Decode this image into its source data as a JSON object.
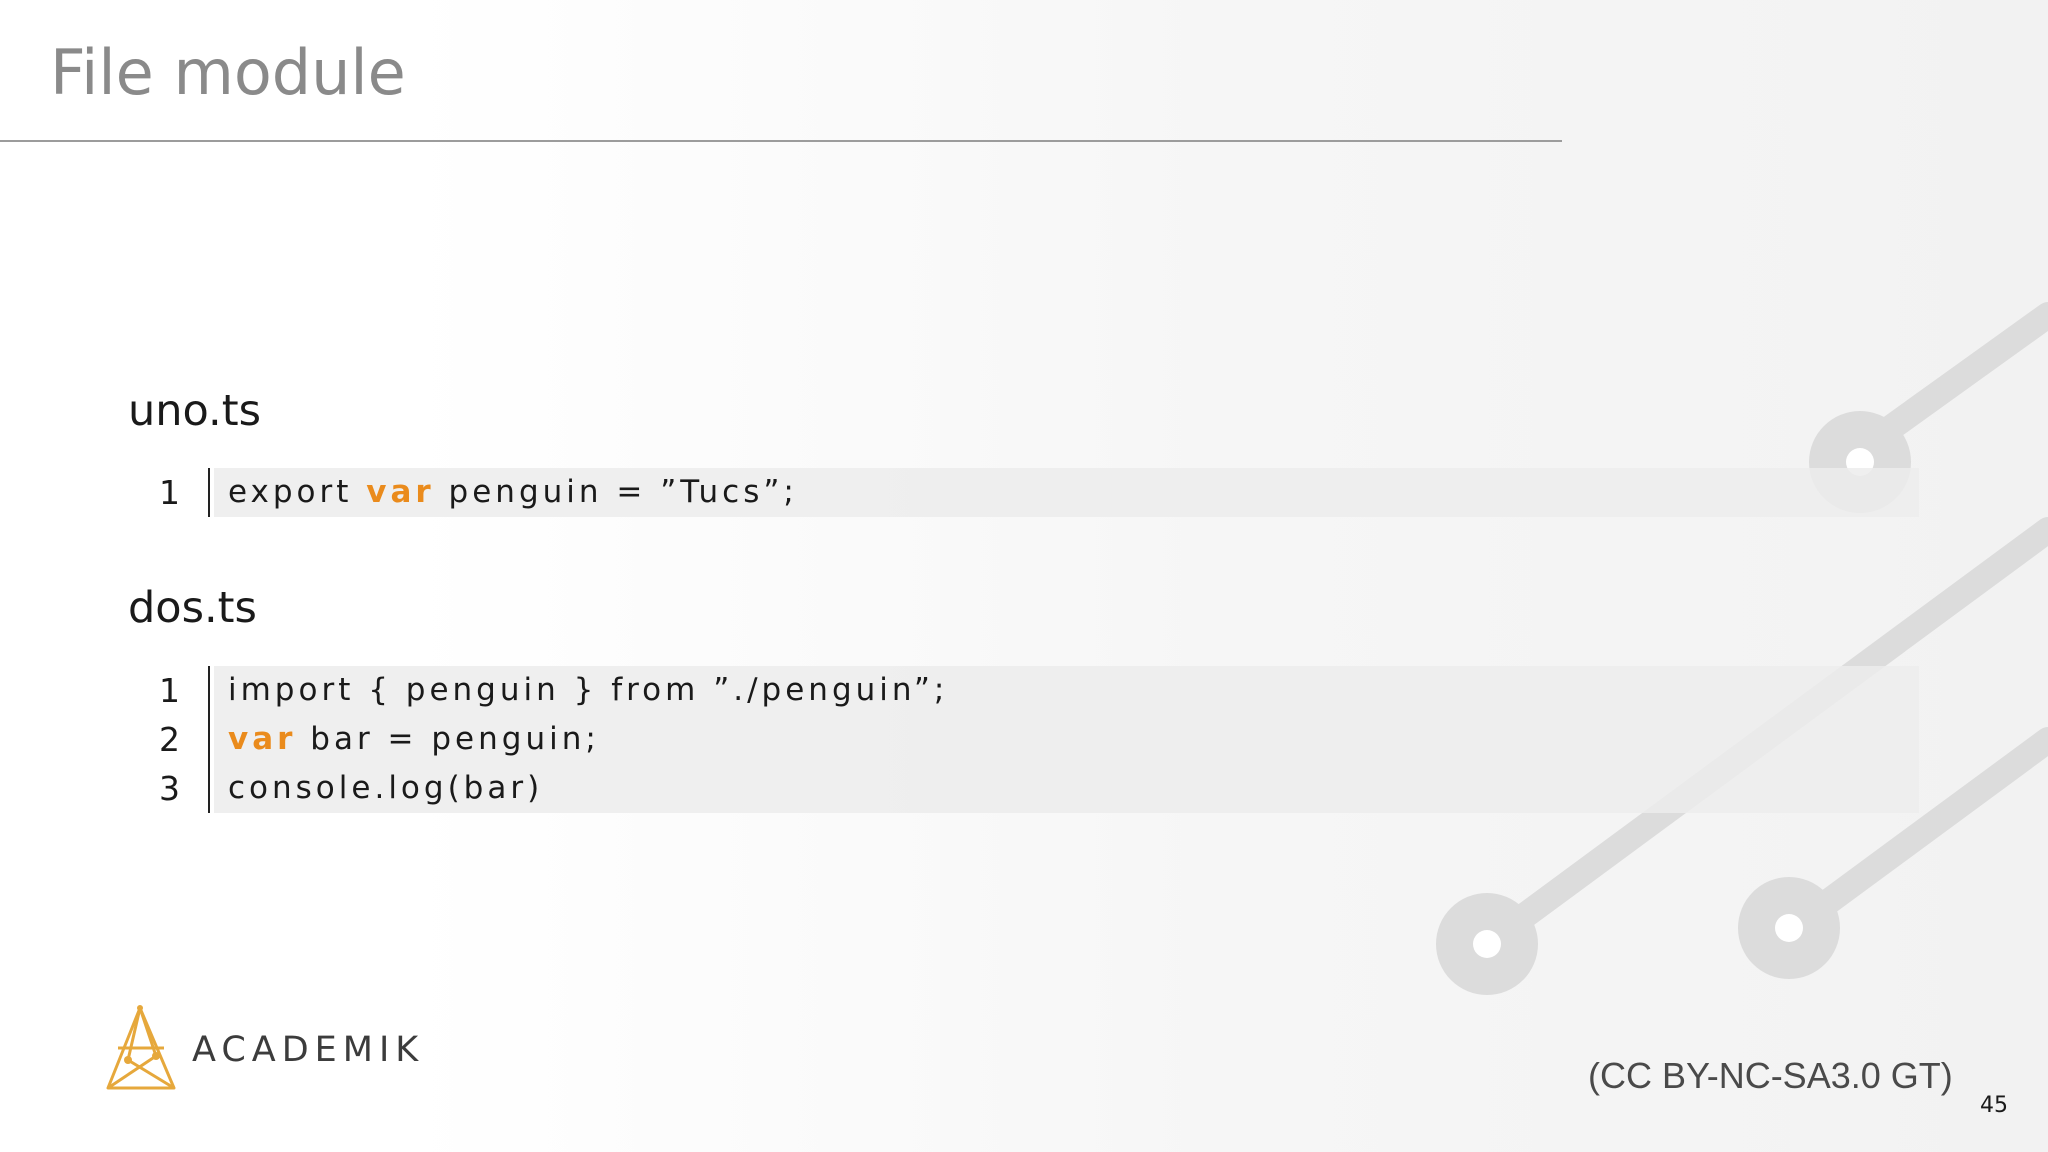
{
  "slide": {
    "title": "File module",
    "page_number": "45",
    "license": "(CC BY-NC-SA3.0 GT)",
    "logo_text": "ACADEMIK"
  },
  "files": [
    {
      "name": "uno.ts",
      "lines": [
        {
          "number": "1",
          "tokens": [
            {
              "text": "export ",
              "keyword": false
            },
            {
              "text": "var",
              "keyword": true
            },
            {
              "text": " penguin = ”Tucs”;",
              "keyword": false
            }
          ]
        }
      ]
    },
    {
      "name": "dos.ts",
      "lines": [
        {
          "number": "1",
          "tokens": [
            {
              "text": "import { penguin } from ”./penguin”;",
              "keyword": false
            }
          ]
        },
        {
          "number": "2",
          "tokens": [
            {
              "text": "var",
              "keyword": true
            },
            {
              "text": " bar = penguin;",
              "keyword": false
            }
          ]
        },
        {
          "number": "3",
          "tokens": [
            {
              "text": "console.log(bar)",
              "keyword": false
            }
          ]
        }
      ]
    }
  ],
  "colors": {
    "keyword": "#ea8b1c",
    "title": "#8a8a8a",
    "logo": "#e6a83c",
    "circuit": "#dcdcdc"
  },
  "icons": [
    "academik-logo-icon",
    "circuit-decoration"
  ]
}
